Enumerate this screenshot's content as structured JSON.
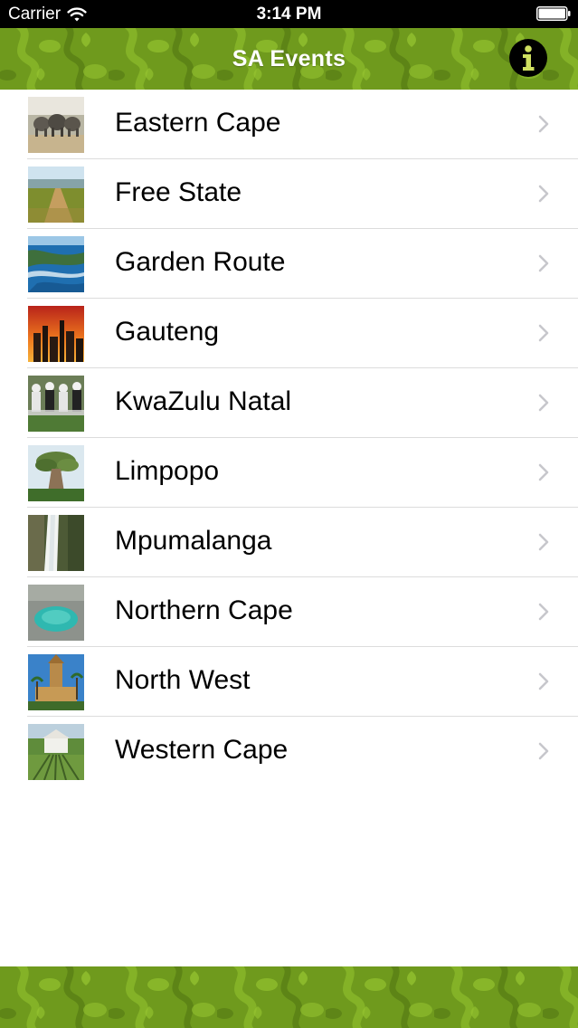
{
  "status_bar": {
    "carrier": "Carrier",
    "time": "3:14 PM",
    "wifi_icon": "wifi-icon",
    "battery_icon": "battery-icon"
  },
  "nav_bar": {
    "title": "SA Events",
    "info_icon": "info-icon",
    "pattern_color": "#6f9a1d"
  },
  "regions": [
    {
      "label": "Eastern Cape",
      "thumb": "elephants-thumbnail"
    },
    {
      "label": "Free State",
      "thumb": "field-road-thumbnail"
    },
    {
      "label": "Garden Route",
      "thumb": "coastline-thumbnail"
    },
    {
      "label": "Gauteng",
      "thumb": "city-sunset-thumbnail"
    },
    {
      "label": "KwaZulu Natal",
      "thumb": "dancers-thumbnail"
    },
    {
      "label": "Limpopo",
      "thumb": "baobab-tree-thumbnail"
    },
    {
      "label": "Mpumalanga",
      "thumb": "waterfall-thumbnail"
    },
    {
      "label": "Northern Cape",
      "thumb": "blue-pool-thumbnail"
    },
    {
      "label": "North West",
      "thumb": "palace-tower-thumbnail"
    },
    {
      "label": "Western Cape",
      "thumb": "vineyard-house-thumbnail"
    }
  ],
  "colors": {
    "accent_green": "#6f9a1d",
    "separator": "#dcdcdc",
    "chevron": "#c7c7cc"
  }
}
